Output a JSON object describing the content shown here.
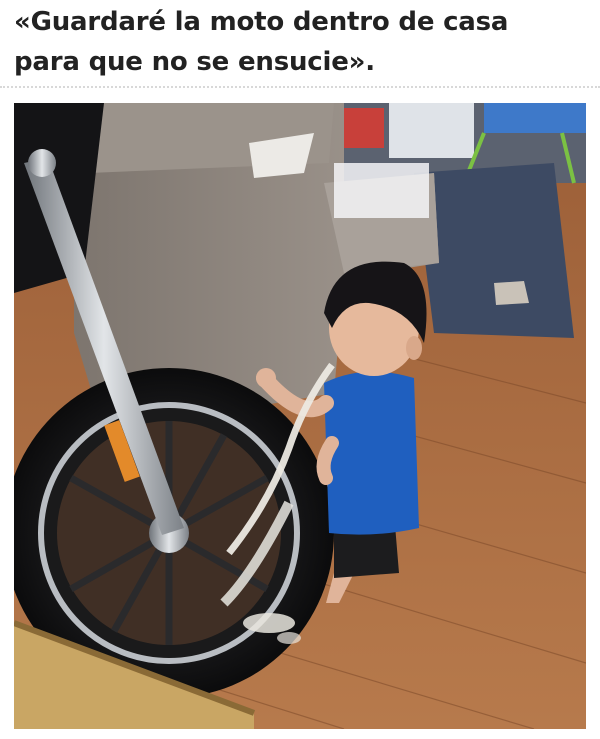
{
  "post": {
    "title_line1": "«Guardaré la moto dentro de casa",
    "title_line2": "para que no se ensucie»."
  },
  "photo": {
    "depicts": "photo-of-toddler-licking-motorcycle-tire-indoors"
  },
  "colors": {
    "title": "#222222",
    "floor": "#a8683e",
    "sofa": "#8f8780",
    "rug": "#3d4a63",
    "shirt": "#1f5fbf"
  }
}
